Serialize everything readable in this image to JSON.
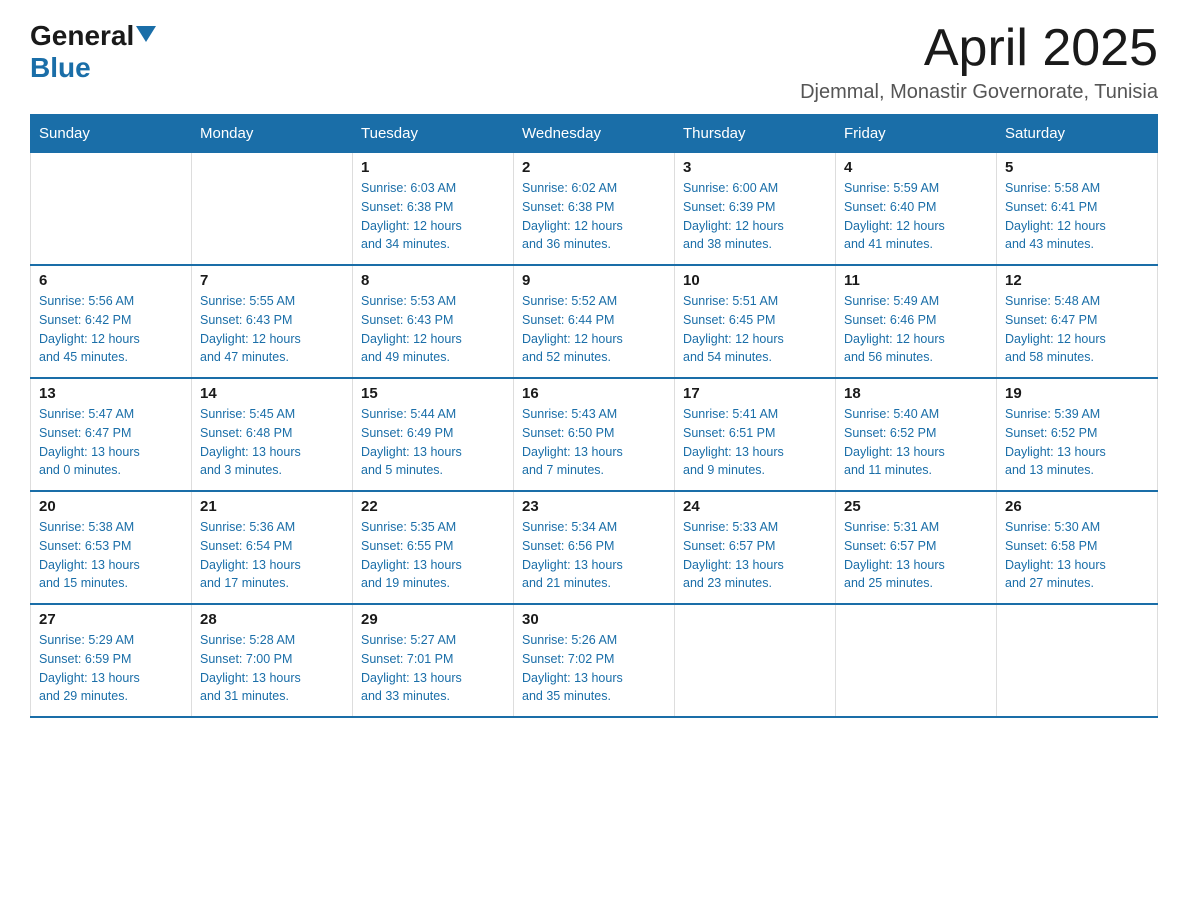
{
  "logo": {
    "text_general": "General",
    "text_blue": "Blue"
  },
  "title": "April 2025",
  "subtitle": "Djemmal, Monastir Governorate, Tunisia",
  "weekdays": [
    "Sunday",
    "Monday",
    "Tuesday",
    "Wednesday",
    "Thursday",
    "Friday",
    "Saturday"
  ],
  "weeks": [
    [
      {
        "day": "",
        "info": ""
      },
      {
        "day": "",
        "info": ""
      },
      {
        "day": "1",
        "info": "Sunrise: 6:03 AM\nSunset: 6:38 PM\nDaylight: 12 hours\nand 34 minutes."
      },
      {
        "day": "2",
        "info": "Sunrise: 6:02 AM\nSunset: 6:38 PM\nDaylight: 12 hours\nand 36 minutes."
      },
      {
        "day": "3",
        "info": "Sunrise: 6:00 AM\nSunset: 6:39 PM\nDaylight: 12 hours\nand 38 minutes."
      },
      {
        "day": "4",
        "info": "Sunrise: 5:59 AM\nSunset: 6:40 PM\nDaylight: 12 hours\nand 41 minutes."
      },
      {
        "day": "5",
        "info": "Sunrise: 5:58 AM\nSunset: 6:41 PM\nDaylight: 12 hours\nand 43 minutes."
      }
    ],
    [
      {
        "day": "6",
        "info": "Sunrise: 5:56 AM\nSunset: 6:42 PM\nDaylight: 12 hours\nand 45 minutes."
      },
      {
        "day": "7",
        "info": "Sunrise: 5:55 AM\nSunset: 6:43 PM\nDaylight: 12 hours\nand 47 minutes."
      },
      {
        "day": "8",
        "info": "Sunrise: 5:53 AM\nSunset: 6:43 PM\nDaylight: 12 hours\nand 49 minutes."
      },
      {
        "day": "9",
        "info": "Sunrise: 5:52 AM\nSunset: 6:44 PM\nDaylight: 12 hours\nand 52 minutes."
      },
      {
        "day": "10",
        "info": "Sunrise: 5:51 AM\nSunset: 6:45 PM\nDaylight: 12 hours\nand 54 minutes."
      },
      {
        "day": "11",
        "info": "Sunrise: 5:49 AM\nSunset: 6:46 PM\nDaylight: 12 hours\nand 56 minutes."
      },
      {
        "day": "12",
        "info": "Sunrise: 5:48 AM\nSunset: 6:47 PM\nDaylight: 12 hours\nand 58 minutes."
      }
    ],
    [
      {
        "day": "13",
        "info": "Sunrise: 5:47 AM\nSunset: 6:47 PM\nDaylight: 13 hours\nand 0 minutes."
      },
      {
        "day": "14",
        "info": "Sunrise: 5:45 AM\nSunset: 6:48 PM\nDaylight: 13 hours\nand 3 minutes."
      },
      {
        "day": "15",
        "info": "Sunrise: 5:44 AM\nSunset: 6:49 PM\nDaylight: 13 hours\nand 5 minutes."
      },
      {
        "day": "16",
        "info": "Sunrise: 5:43 AM\nSunset: 6:50 PM\nDaylight: 13 hours\nand 7 minutes."
      },
      {
        "day": "17",
        "info": "Sunrise: 5:41 AM\nSunset: 6:51 PM\nDaylight: 13 hours\nand 9 minutes."
      },
      {
        "day": "18",
        "info": "Sunrise: 5:40 AM\nSunset: 6:52 PM\nDaylight: 13 hours\nand 11 minutes."
      },
      {
        "day": "19",
        "info": "Sunrise: 5:39 AM\nSunset: 6:52 PM\nDaylight: 13 hours\nand 13 minutes."
      }
    ],
    [
      {
        "day": "20",
        "info": "Sunrise: 5:38 AM\nSunset: 6:53 PM\nDaylight: 13 hours\nand 15 minutes."
      },
      {
        "day": "21",
        "info": "Sunrise: 5:36 AM\nSunset: 6:54 PM\nDaylight: 13 hours\nand 17 minutes."
      },
      {
        "day": "22",
        "info": "Sunrise: 5:35 AM\nSunset: 6:55 PM\nDaylight: 13 hours\nand 19 minutes."
      },
      {
        "day": "23",
        "info": "Sunrise: 5:34 AM\nSunset: 6:56 PM\nDaylight: 13 hours\nand 21 minutes."
      },
      {
        "day": "24",
        "info": "Sunrise: 5:33 AM\nSunset: 6:57 PM\nDaylight: 13 hours\nand 23 minutes."
      },
      {
        "day": "25",
        "info": "Sunrise: 5:31 AM\nSunset: 6:57 PM\nDaylight: 13 hours\nand 25 minutes."
      },
      {
        "day": "26",
        "info": "Sunrise: 5:30 AM\nSunset: 6:58 PM\nDaylight: 13 hours\nand 27 minutes."
      }
    ],
    [
      {
        "day": "27",
        "info": "Sunrise: 5:29 AM\nSunset: 6:59 PM\nDaylight: 13 hours\nand 29 minutes."
      },
      {
        "day": "28",
        "info": "Sunrise: 5:28 AM\nSunset: 7:00 PM\nDaylight: 13 hours\nand 31 minutes."
      },
      {
        "day": "29",
        "info": "Sunrise: 5:27 AM\nSunset: 7:01 PM\nDaylight: 13 hours\nand 33 minutes."
      },
      {
        "day": "30",
        "info": "Sunrise: 5:26 AM\nSunset: 7:02 PM\nDaylight: 13 hours\nand 35 minutes."
      },
      {
        "day": "",
        "info": ""
      },
      {
        "day": "",
        "info": ""
      },
      {
        "day": "",
        "info": ""
      }
    ]
  ]
}
